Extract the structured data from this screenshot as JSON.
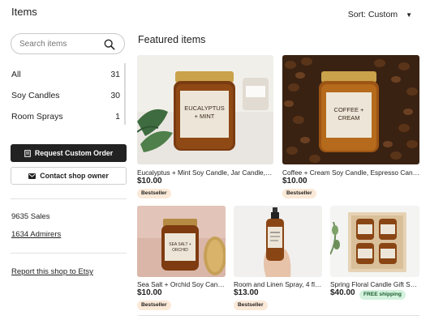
{
  "header": {
    "title": "Items",
    "sort_label": "Sort: Custom"
  },
  "search": {
    "placeholder": "Search items"
  },
  "categories": [
    {
      "label": "All",
      "count": "31"
    },
    {
      "label": "Soy Candles",
      "count": "30"
    },
    {
      "label": "Room Sprays",
      "count": "1"
    }
  ],
  "actions": {
    "request_label": "Request Custom Order",
    "contact_label": "Contact shop owner"
  },
  "shop_stats": {
    "sales": "9635 Sales",
    "admirers": "1634 Admirers",
    "report": "Report this shop to Etsy"
  },
  "featured": {
    "heading": "Featured items",
    "items": [
      {
        "title": "Eucalyptus + Mint Soy Candle, Jar Candle, Aro...",
        "price": "$10.00",
        "badge": "Bestseller",
        "label_line1": "EUCALYPTUS",
        "label_line2": "+ MINT"
      },
      {
        "title": "Coffee + Cream Soy Candle, Espresso Candle,...",
        "price": "$10.00",
        "badge": "Bestseller",
        "label_line1": "COFFEE +",
        "label_line2": "CREAM"
      },
      {
        "title": "Sea Salt + Orchid Soy Candl...",
        "price": "$10.00",
        "badge": "Bestseller",
        "label_line1": "SEA SALT +",
        "label_line2": "ORCHID"
      },
      {
        "title": "Room and Linen Spray, 4 fl o...",
        "price": "$13.00",
        "badge": "Bestseller"
      },
      {
        "title": "Spring Floral Candle Gift Set...",
        "price": "$40.00",
        "badge": "FREE shipping"
      }
    ]
  },
  "colors": {
    "dark_button": "#222222",
    "bestseller_badge": "#fbe9d8",
    "free_shipping_badge": "#d4f2dd"
  },
  "icons": {
    "search": "search-icon",
    "request": "document-icon",
    "contact": "mail-icon",
    "sort": "caret-down-icon"
  }
}
